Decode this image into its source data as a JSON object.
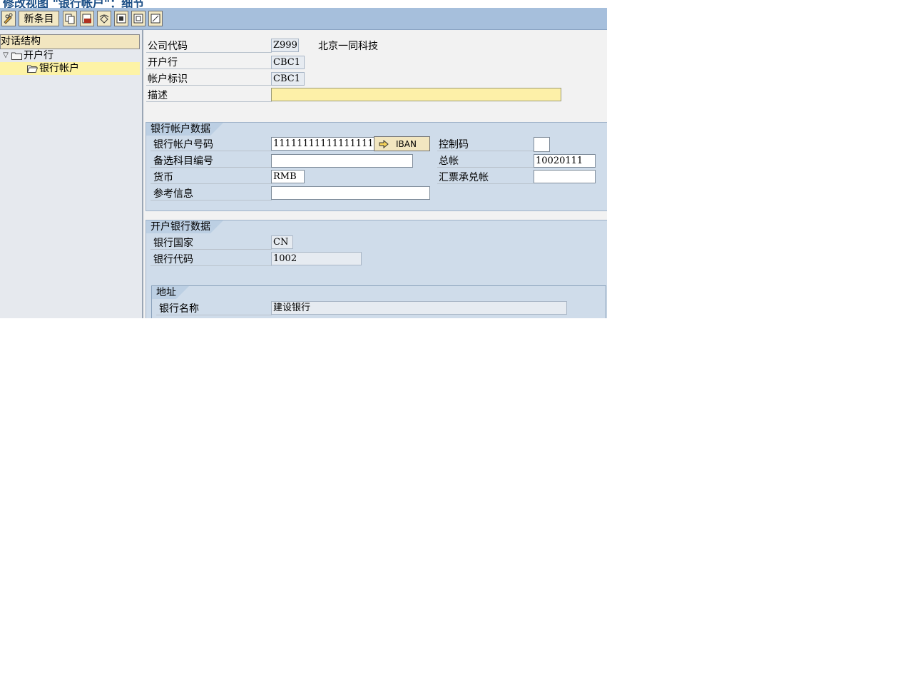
{
  "window": {
    "title": "修改视图 \"银行帐户\"：细节"
  },
  "toolbar": {
    "new_entries_label": "新条目"
  },
  "tree": {
    "header": "对话结构",
    "items": [
      {
        "label": "开户行"
      },
      {
        "label": "银行帐户"
      }
    ]
  },
  "header_fields": {
    "company_code_label": "公司代码",
    "company_code_value": "Z999",
    "company_name": "北京一同科技",
    "house_bank_label": "开户行",
    "house_bank_value": "CBC1",
    "account_id_label": "帐户标识",
    "account_id_value": "CBC1",
    "description_label": "描述",
    "description_value": ""
  },
  "bank_account_data": {
    "title": "银行帐户数据",
    "account_number_label": "银行帐户号码",
    "account_number_value": "11111111111111111",
    "iban_button": "IBAN",
    "control_key_label": "控制码",
    "control_key_value": "",
    "alt_account_label": "备选科目编号",
    "alt_account_value": "",
    "gl_account_label": "总帐",
    "gl_account_value": "10020111",
    "currency_label": "货币",
    "currency_value": "RMB",
    "bill_acceptance_label": "汇票承兑帐",
    "bill_acceptance_value": "",
    "reference_label": "参考信息",
    "reference_value": ""
  },
  "house_bank_data": {
    "title": "开户银行数据",
    "bank_country_label": "银行国家",
    "bank_country_value": "CN",
    "bank_key_label": "银行代码",
    "bank_key_value": "1002",
    "address": {
      "title": "地址",
      "bank_name_label": "银行名称",
      "bank_name_value": "建设银行"
    }
  },
  "colors": {
    "toolbar_bg": "#a6bfdc",
    "group_bg": "#cfdcea",
    "required_field": "#fdf0a8",
    "selected_tree": "#fdf3a6",
    "title_text": "#1c4f86"
  }
}
